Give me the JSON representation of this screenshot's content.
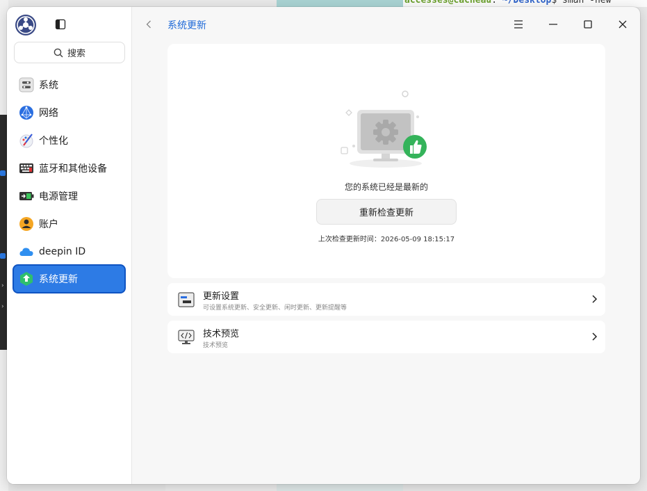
{
  "background": {
    "terminal_line_green": "accesses@cacheau",
    "terminal_line_mid": ": ",
    "terminal_line_blue": "~/Desktop",
    "terminal_line_end": "$ sman -new"
  },
  "sidebar": {
    "search_placeholder": "搜索",
    "items": [
      {
        "label": "系统",
        "icon": "system-icon"
      },
      {
        "label": "网络",
        "icon": "network-icon"
      },
      {
        "label": "个性化",
        "icon": "personalization-icon"
      },
      {
        "label": "蓝牙和其他设备",
        "icon": "bluetooth-devices-icon"
      },
      {
        "label": "电源管理",
        "icon": "power-icon"
      },
      {
        "label": "账户",
        "icon": "account-icon"
      },
      {
        "label": "deepin ID",
        "icon": "cloud-icon"
      },
      {
        "label": "系统更新",
        "icon": "update-icon",
        "active": true
      }
    ]
  },
  "header": {
    "breadcrumb": "系统更新"
  },
  "update": {
    "status": "您的系统已经是最新的",
    "recheck_label": "重新检查更新",
    "last_check": "上次检查更新时间：2026-05-09 18:15:17"
  },
  "rows": [
    {
      "title": "更新设置",
      "subtitle": "可设置系统更新、安全更新、闲时更新、更新提醒等",
      "icon": "update-settings-icon"
    },
    {
      "title": "技术预览",
      "subtitle": "技术预览",
      "icon": "tech-preview-icon"
    }
  ],
  "colors": {
    "accent": "#2d7be5",
    "breadcrumb": "#1f6ad8",
    "success": "#34b35a"
  }
}
